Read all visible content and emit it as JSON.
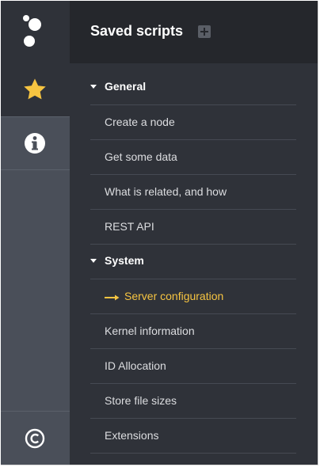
{
  "sidebar": {
    "items": [
      {
        "name": "favorites",
        "icon": "star-icon",
        "active": true
      },
      {
        "name": "info",
        "icon": "info-icon",
        "active": false
      },
      {
        "name": "about",
        "icon": "copyright-icon",
        "active": false
      }
    ]
  },
  "panel": {
    "title": "Saved scripts",
    "add_icon": "plus-square-icon"
  },
  "folders": [
    {
      "label": "General",
      "items": [
        {
          "label": "Create a node"
        },
        {
          "label": "Get some data"
        },
        {
          "label": "What is related, and how"
        },
        {
          "label": "REST API"
        }
      ]
    },
    {
      "label": "System",
      "items": [
        {
          "label": "Server configuration",
          "active": true
        },
        {
          "label": "Kernel information"
        },
        {
          "label": "ID Allocation"
        },
        {
          "label": "Store file sizes"
        },
        {
          "label": "Extensions"
        }
      ]
    }
  ],
  "colors": {
    "accent": "#f6c441",
    "sidebar_bg": "#4a4f59",
    "panel_bg": "#2f3239",
    "header_bg": "#25272c"
  }
}
